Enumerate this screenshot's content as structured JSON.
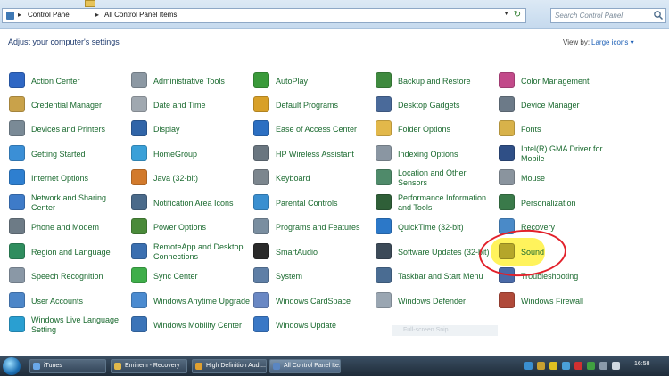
{
  "address_bar": {
    "crumbs": [
      "Control Panel",
      "All Control Panel Items"
    ],
    "separator": "▸",
    "search_placeholder": "Search Control Panel"
  },
  "header": {
    "heading": "Adjust your computer's settings",
    "view_by_label": "View by:",
    "view_by_value": "Large icons ▾"
  },
  "columns": [
    [
      {
        "label": "Action Center",
        "icon": "flag-icon",
        "color": "#2f67c4"
      },
      {
        "label": "Credential Manager",
        "icon": "vault-icon",
        "color": "#c9a24a"
      },
      {
        "label": "Devices and Printers",
        "icon": "printer-icon",
        "color": "#7a8a96"
      },
      {
        "label": "Getting Started",
        "icon": "getting-started-icon",
        "color": "#3b8fd6"
      },
      {
        "label": "Internet Options",
        "icon": "globe-icon",
        "color": "#2e7fd0"
      },
      {
        "label": "Network and Sharing Center",
        "icon": "network-icon",
        "color": "#3e7bc8"
      },
      {
        "label": "Phone and Modem",
        "icon": "phone-icon",
        "color": "#6d7b86"
      },
      {
        "label": "Region and Language",
        "icon": "region-globe-icon",
        "color": "#2f8d5e"
      },
      {
        "label": "Speech Recognition",
        "icon": "microphone-icon",
        "color": "#8a98a6"
      },
      {
        "label": "User Accounts",
        "icon": "users-icon",
        "color": "#4d86c8"
      },
      {
        "label": "Windows Live Language Setting",
        "icon": "language-icon",
        "color": "#2a9fd1"
      }
    ],
    [
      {
        "label": "Administrative Tools",
        "icon": "admin-tools-icon",
        "color": "#8c98a3"
      },
      {
        "label": "Date and Time",
        "icon": "clock-icon",
        "color": "#a0a8b0"
      },
      {
        "label": "Display",
        "icon": "monitor-icon",
        "color": "#3165a8"
      },
      {
        "label": "HomeGroup",
        "icon": "homegroup-icon",
        "color": "#3aa0d8"
      },
      {
        "label": "Java (32-bit)",
        "icon": "java-icon",
        "color": "#d27a2c"
      },
      {
        "label": "Notification Area Icons",
        "icon": "notification-icon",
        "color": "#4a6a8a"
      },
      {
        "label": "Power Options",
        "icon": "power-icon",
        "color": "#4a8a3a"
      },
      {
        "label": "RemoteApp and Desktop Connections",
        "icon": "remoteapp-icon",
        "color": "#3b6fb0"
      },
      {
        "label": "Sync Center",
        "icon": "sync-icon",
        "color": "#3fae4a"
      },
      {
        "label": "Windows Anytime Upgrade",
        "icon": "anytime-upgrade-icon",
        "color": "#4b8bd0"
      },
      {
        "label": "Windows Mobility Center",
        "icon": "mobility-icon",
        "color": "#3b74b8"
      }
    ],
    [
      {
        "label": "AutoPlay",
        "icon": "autoplay-icon",
        "color": "#3a9a3a"
      },
      {
        "label": "Default Programs",
        "icon": "default-programs-icon",
        "color": "#d8a028"
      },
      {
        "label": "Ease of Access Center",
        "icon": "ease-access-icon",
        "color": "#2c6fc2"
      },
      {
        "label": "HP Wireless Assistant",
        "icon": "wireless-icon",
        "color": "#6a7680"
      },
      {
        "label": "Keyboard",
        "icon": "keyboard-icon",
        "color": "#7c868e"
      },
      {
        "label": "Parental Controls",
        "icon": "parental-icon",
        "color": "#3a8fd0"
      },
      {
        "label": "Programs and Features",
        "icon": "programs-icon",
        "color": "#7a8ea0"
      },
      {
        "label": "SmartAudio",
        "icon": "headphones-icon",
        "color": "#2a2a2a"
      },
      {
        "label": "System",
        "icon": "system-icon",
        "color": "#5f7fa6"
      },
      {
        "label": "Windows CardSpace",
        "icon": "cardspace-icon",
        "color": "#6a88c4"
      },
      {
        "label": "Windows Update",
        "icon": "windows-update-icon",
        "color": "#3a78c6"
      }
    ],
    [
      {
        "label": "Backup and Restore",
        "icon": "backup-icon",
        "color": "#3f8a3f"
      },
      {
        "label": "Desktop Gadgets",
        "icon": "gadgets-icon",
        "color": "#4a6a9a"
      },
      {
        "label": "Folder Options",
        "icon": "folder-icon",
        "color": "#e2b84a"
      },
      {
        "label": "Indexing Options",
        "icon": "indexing-icon",
        "color": "#8a96a2"
      },
      {
        "label": "Location and Other Sensors",
        "icon": "sensors-icon",
        "color": "#4f8a6a"
      },
      {
        "label": "Performance Information and Tools",
        "icon": "performance-icon",
        "color": "#2f5f38"
      },
      {
        "label": "QuickTime (32-bit)",
        "icon": "quicktime-icon",
        "color": "#2c78c8"
      },
      {
        "label": "Software Updates (32-bit)",
        "icon": "software-updates-icon",
        "color": "#3c4a58"
      },
      {
        "label": "Taskbar and Start Menu",
        "icon": "taskbar-icon",
        "color": "#4a6c92"
      },
      {
        "label": "Windows Defender",
        "icon": "defender-icon",
        "color": "#9aa6b2"
      },
      {
        "label": "",
        "icon": "",
        "color": ""
      }
    ],
    [
      {
        "label": "Color Management",
        "icon": "color-mgmt-icon",
        "color": "#c24a8a"
      },
      {
        "label": "Device Manager",
        "icon": "device-manager-icon",
        "color": "#6c7a88"
      },
      {
        "label": "Fonts",
        "icon": "fonts-icon",
        "color": "#d8b24a"
      },
      {
        "label": "Intel(R) GMA Driver for Mobile",
        "icon": "intel-icon",
        "color": "#2f4f86"
      },
      {
        "label": "Mouse",
        "icon": "mouse-icon",
        "color": "#8a949e"
      },
      {
        "label": "Personalization",
        "icon": "personalization-icon",
        "color": "#3a7a4a"
      },
      {
        "label": "Recovery",
        "icon": "recovery-icon",
        "color": "#4a8ac8"
      },
      {
        "label": "Sound",
        "icon": "speaker-icon",
        "color": "#b5a62a"
      },
      {
        "label": "Troubleshooting",
        "icon": "troubleshooting-icon",
        "color": "#4a6aa8"
      },
      {
        "label": "Windows Firewall",
        "icon": "firewall-icon",
        "color": "#b04a3a"
      },
      {
        "label": "",
        "icon": "",
        "color": ""
      }
    ]
  ],
  "overlay": {
    "fullscreen_snip": "Full-screen Snip"
  },
  "taskbar": {
    "tasks": [
      {
        "label": "iTunes",
        "icon": "itunes-icon",
        "color": "#6aa7e8"
      },
      {
        "label": "Eminem - Recovery",
        "icon": "folder-icon",
        "color": "#e2b84a"
      },
      {
        "label": "High Definition Audi...",
        "icon": "chrome-icon",
        "color": "#e0a030"
      },
      {
        "label": "All Control Panel Ite...",
        "icon": "control-panel-icon",
        "color": "#5a86c2"
      }
    ],
    "tray_icons": [
      {
        "icon": "security-icon",
        "color": "#3a8fd0"
      },
      {
        "icon": "audio-tray-icon",
        "color": "#c8a030"
      },
      {
        "icon": "alert-icon",
        "color": "#e0c020"
      },
      {
        "icon": "network-tray-icon",
        "color": "#4aa0d8"
      },
      {
        "icon": "antivirus-icon",
        "color": "#d03030"
      },
      {
        "icon": "power-tray-icon",
        "color": "#40a040"
      },
      {
        "icon": "wifi-tray-icon",
        "color": "#8a9aaa"
      },
      {
        "icon": "volume-tray-icon",
        "color": "#cfd8e0"
      }
    ],
    "clock": "16:58"
  }
}
